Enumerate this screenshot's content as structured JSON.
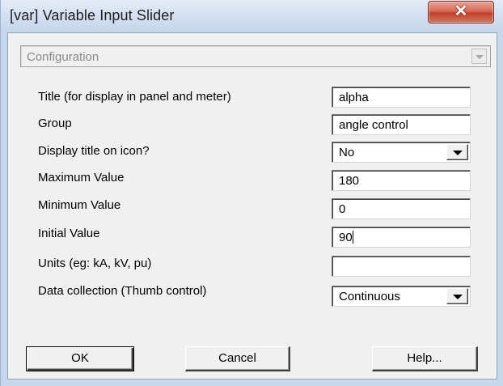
{
  "window": {
    "title": "[var] Variable Input Slider",
    "close_glyph": "✕",
    "colors": {
      "frame": "#c7d8ec",
      "close_button": "#c0402b",
      "client_bg": "#f0f0f0"
    }
  },
  "configuration": {
    "selected": "Configuration",
    "disabled": true
  },
  "fields": [
    {
      "label": "Title (for display in panel and meter)",
      "value": "alpha",
      "type": "text"
    },
    {
      "label": "Group",
      "value": "angle control",
      "type": "text"
    },
    {
      "label": "Display title on icon?",
      "value": "No",
      "type": "dropdown"
    },
    {
      "label": "Maximum Value",
      "value": "180",
      "type": "text"
    },
    {
      "label": "Minimum Value",
      "value": "0",
      "type": "text"
    },
    {
      "label": "Initial Value",
      "value": "90",
      "type": "text",
      "focused": true
    },
    {
      "label": "Units (eg: kA, kV, pu)",
      "value": "",
      "type": "text"
    },
    {
      "label": "Data collection (Thumb control)",
      "value": "Continuous",
      "type": "dropdown"
    }
  ],
  "buttons": {
    "ok": "OK",
    "cancel": "Cancel",
    "help": "Help..."
  },
  "icons": {
    "close": "close-icon",
    "dropdown": "chevron-down-icon"
  }
}
